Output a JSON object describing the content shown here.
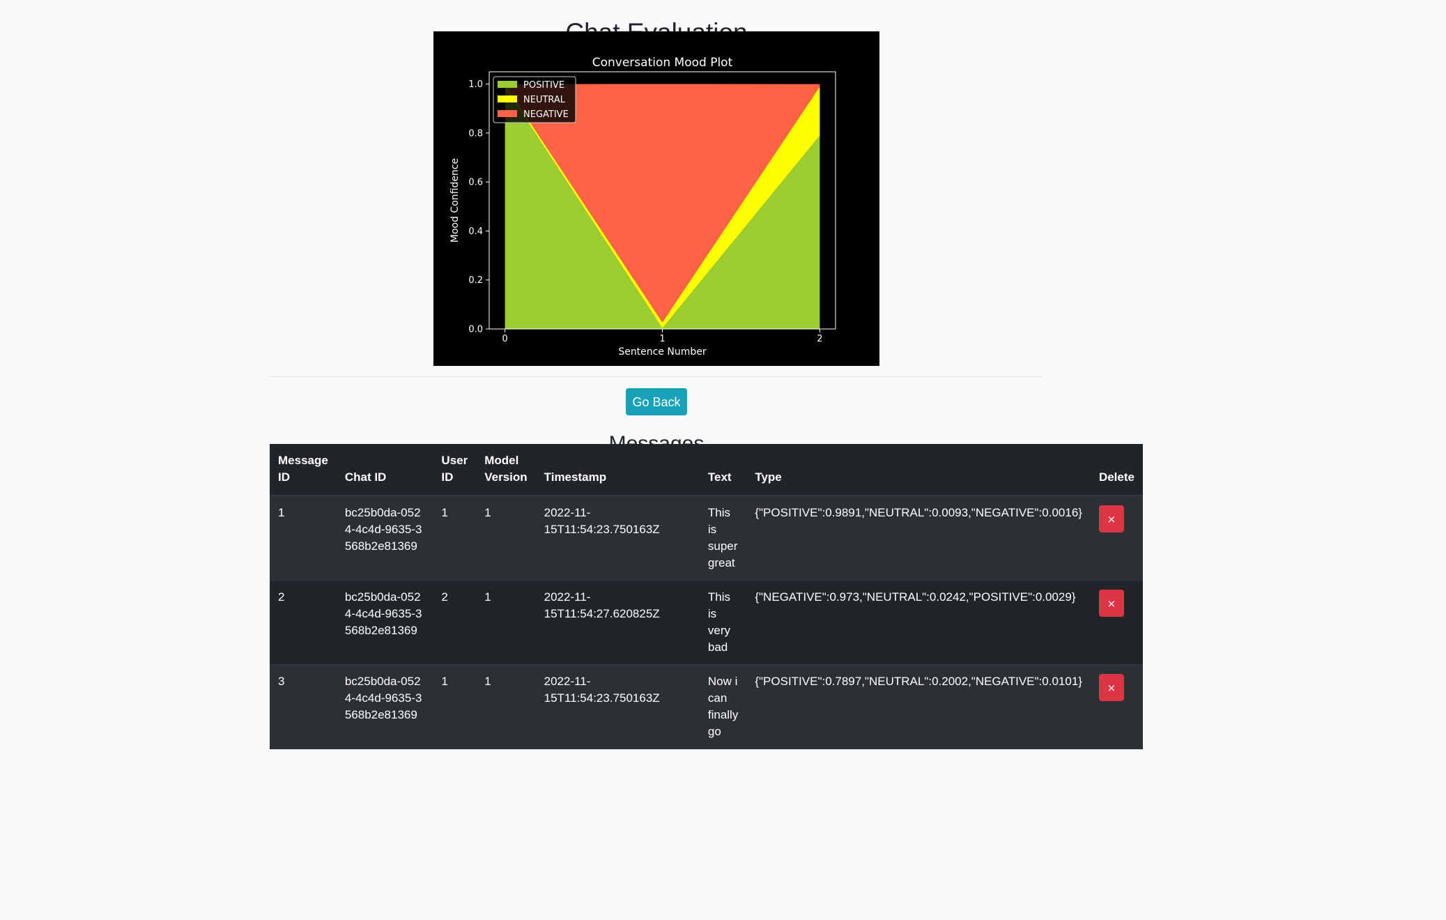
{
  "page": {
    "title": "Chat Evaluation",
    "back_label": "Go Back",
    "messages_title": "Messages"
  },
  "chart_data": {
    "type": "area",
    "stacked": true,
    "title": "Conversation Mood Plot",
    "xlabel": "Sentence Number",
    "ylabel": "Mood Confidence",
    "x": [
      0,
      1,
      2
    ],
    "x_ticks": [
      "0",
      "1",
      "2"
    ],
    "y_ticks": [
      "0.0",
      "0.2",
      "0.4",
      "0.6",
      "0.8",
      "1.0"
    ],
    "xlim": [
      -0.1,
      2.1
    ],
    "ylim": [
      0,
      1.05
    ],
    "legend_position": "top-left",
    "grid": false,
    "background": "#000000",
    "series": [
      {
        "name": "POSITIVE",
        "values": [
          0.9891,
          0.0029,
          0.7897
        ],
        "color": "#9acd32"
      },
      {
        "name": "NEUTRAL",
        "values": [
          0.0093,
          0.0242,
          0.2002
        ],
        "color": "#ffff00"
      },
      {
        "name": "NEGATIVE",
        "values": [
          0.0016,
          0.973,
          0.0101
        ],
        "color": "#ff6347"
      }
    ]
  },
  "table": {
    "headers": {
      "message_id": "Message ID",
      "chat_id": "Chat ID",
      "user_id": "User ID",
      "model_version": "Model Version",
      "timestamp": "Timestamp",
      "text": "Text",
      "type": "Type",
      "delete": "Delete"
    },
    "rows": [
      {
        "message_id": "1",
        "chat_id": "bc25b0da-0524-4c4d-9635-3568b2e81369",
        "user_id": "1",
        "model_version": "1",
        "timestamp": "2022-11-15T11:54:23.750163Z",
        "text": "This is super great",
        "type": "{\"POSITIVE\":0.9891,\"NEUTRAL\":0.0093,\"NEGATIVE\":0.0016}",
        "delete_label": "×"
      },
      {
        "message_id": "2",
        "chat_id": "bc25b0da-0524-4c4d-9635-3568b2e81369",
        "user_id": "2",
        "model_version": "1",
        "timestamp": "2022-11-15T11:54:27.620825Z",
        "text": "This is very bad",
        "type": "{\"NEGATIVE\":0.973,\"NEUTRAL\":0.0242,\"POSITIVE\":0.0029}",
        "delete_label": "×"
      },
      {
        "message_id": "3",
        "chat_id": "bc25b0da-0524-4c4d-9635-3568b2e81369",
        "user_id": "1",
        "model_version": "1",
        "timestamp": "2022-11-15T11:54:23.750163Z",
        "text": "Now i can finally go",
        "type": "{\"POSITIVE\":0.7897,\"NEUTRAL\":0.2002,\"NEGATIVE\":0.0101}",
        "delete_label": "×"
      }
    ]
  }
}
